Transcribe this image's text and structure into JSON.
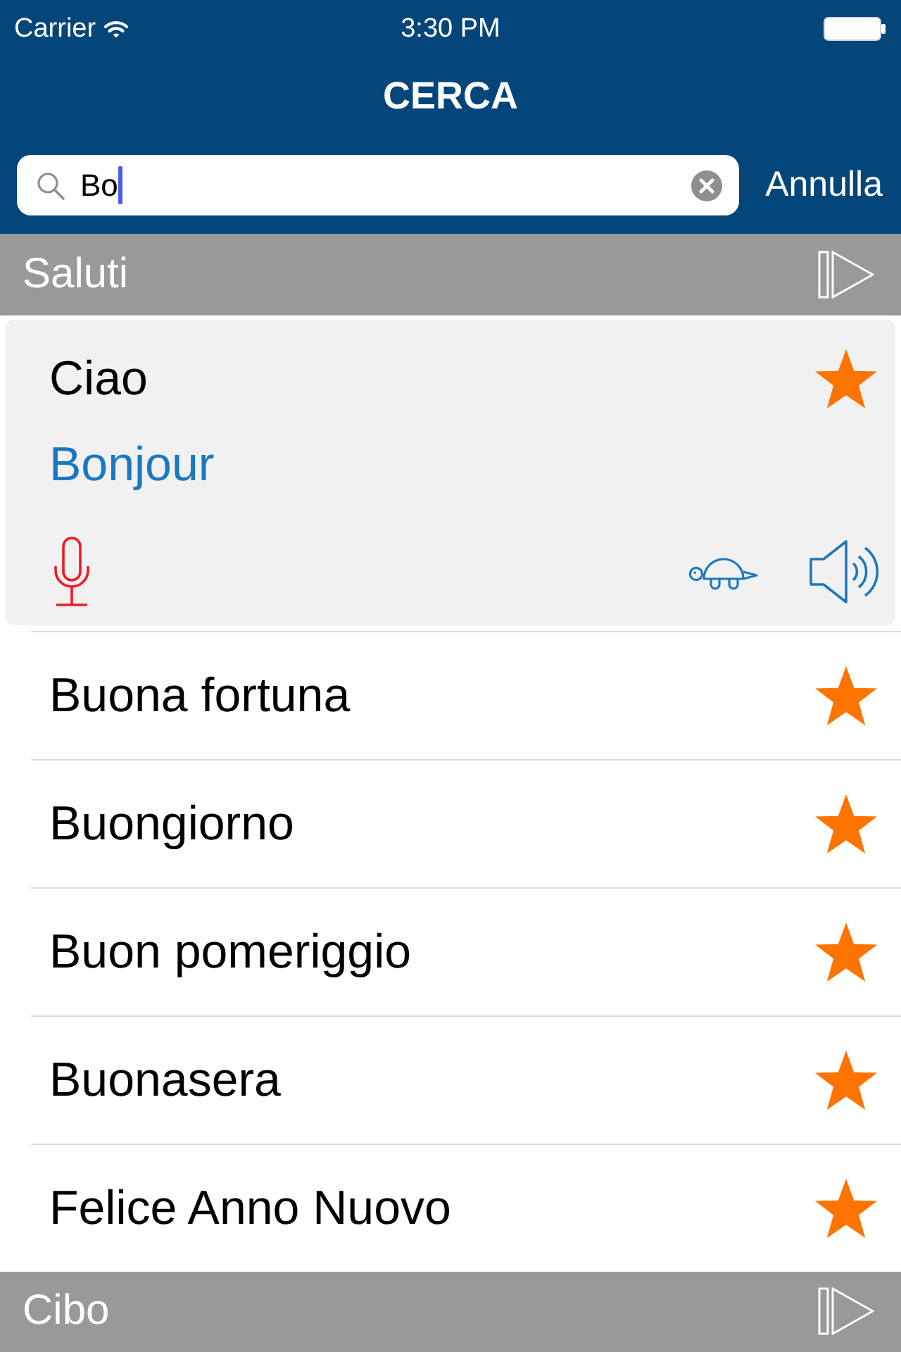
{
  "status_bar": {
    "carrier": "Carrier",
    "time": "3:30 PM"
  },
  "nav_bar": {
    "title": "CERCA"
  },
  "search": {
    "value": "Bo",
    "cancel_button": "Annulla"
  },
  "sections": [
    {
      "title": "Saluti",
      "phrases": [
        {
          "text": "Ciao",
          "translation": "Bonjour",
          "expanded": true,
          "favorite": true
        },
        {
          "text": "Buona fortuna",
          "expanded": false,
          "favorite": true
        },
        {
          "text": "Buongiorno",
          "expanded": false,
          "favorite": true
        },
        {
          "text": "Buon pomeriggio",
          "expanded": false,
          "favorite": true
        },
        {
          "text": "Buonasera",
          "expanded": false,
          "favorite": true
        },
        {
          "text": "Felice Anno Nuovo",
          "expanded": false,
          "favorite": true
        }
      ]
    },
    {
      "title": "Cibo"
    }
  ]
}
